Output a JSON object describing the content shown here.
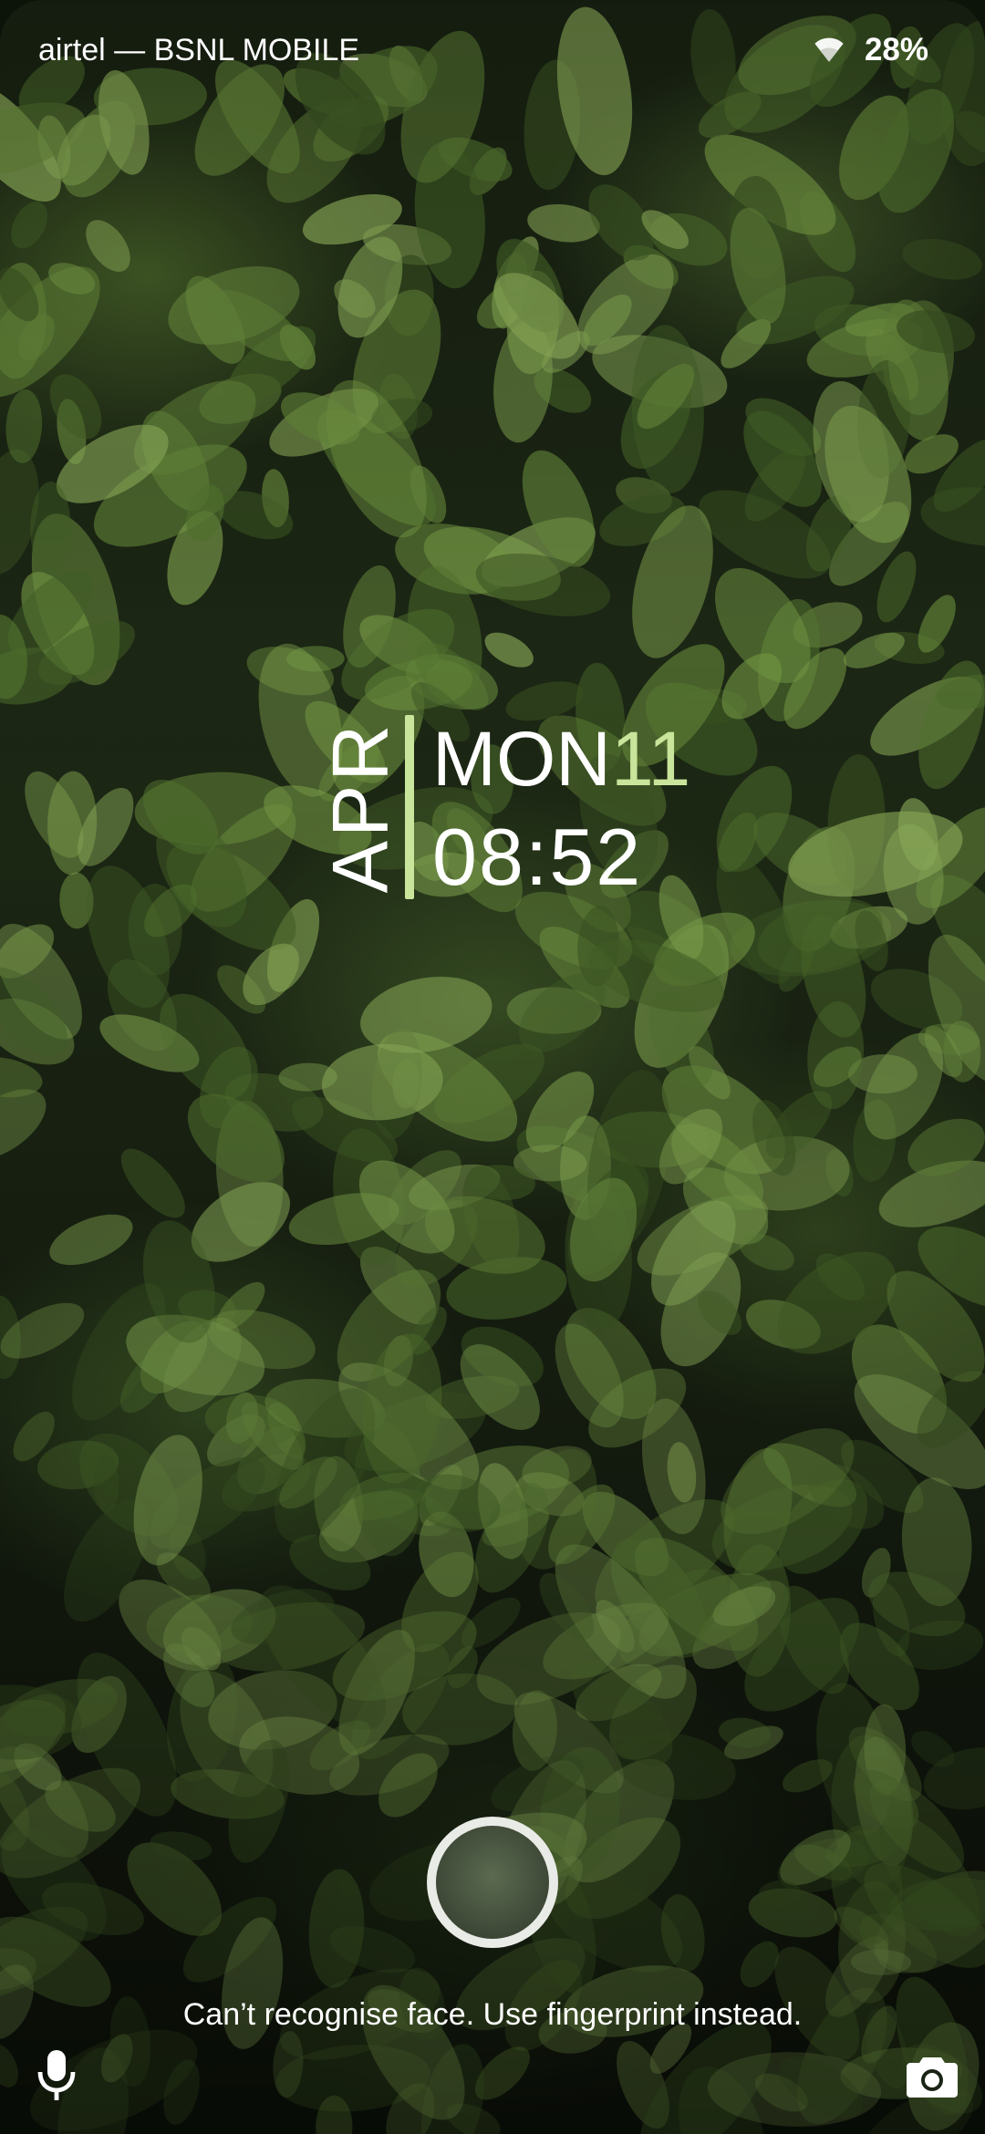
{
  "status_bar": {
    "carrier": "airtel — BSNL MOBILE",
    "battery": "28%"
  },
  "clock": {
    "month": "APR",
    "day_name": "MON",
    "day_number": "11",
    "time": "08:52"
  },
  "face_unlock": {
    "message": "Can’t recognise face. Use fingerprint instead."
  },
  "shortcuts": {
    "left": "microphone-icon",
    "right": "camera-icon"
  },
  "colors": {
    "accent": "#c9e59c",
    "text": "#ffffff"
  }
}
